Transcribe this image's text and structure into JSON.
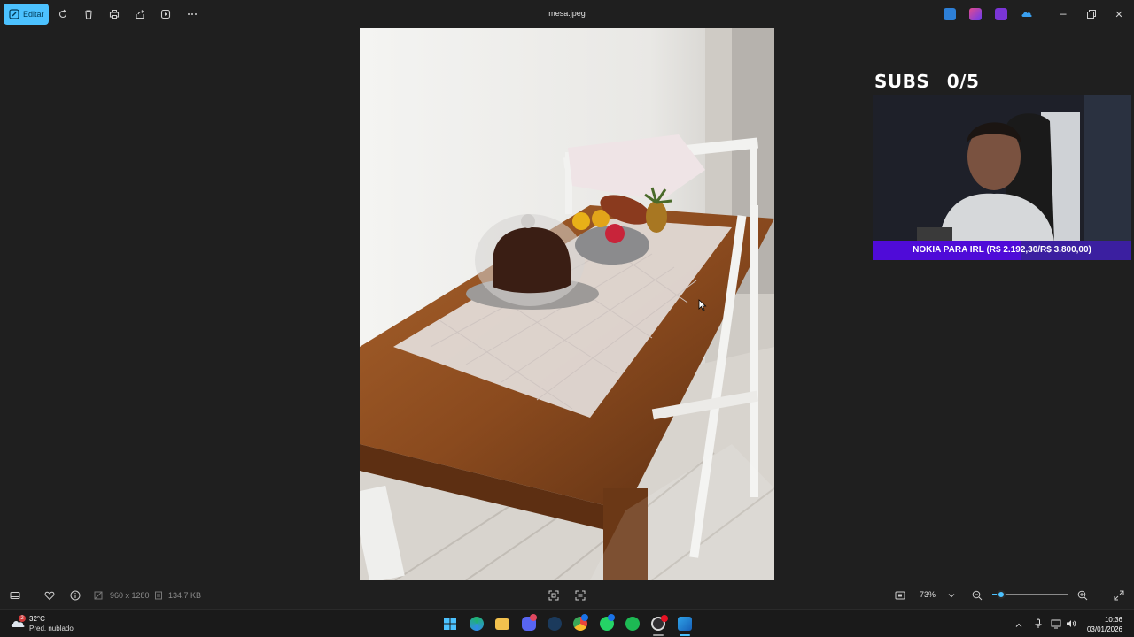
{
  "toolbar": {
    "edit_label": "Editar",
    "file_title": "mesa.jpeg",
    "icons": [
      "edit-icon",
      "rotate-icon",
      "delete-icon",
      "print-icon",
      "share-icon",
      "slideshow-icon",
      "more-icon"
    ]
  },
  "window_controls": [
    "minimize",
    "maximize",
    "close"
  ],
  "overlay": {
    "subs_label": "SUBS",
    "subs_count": "0/5",
    "goal_text": "NOKIA PARA IRL (R$ 2.192,30/R$ 3.800,00)",
    "goal_progress": 0.577
  },
  "bottom": {
    "dimensions": "960 x 1280",
    "file_size": "134.7 KB",
    "zoom": "73%",
    "zoom_slider_value": 0.12
  },
  "taskbar": {
    "temperature": "32°C",
    "weather": "Pred. nublado",
    "weather_badge": "2",
    "time": "10:36",
    "date": "03/01/2026",
    "apps": [
      "start",
      "edge",
      "file-explorer",
      "discord",
      "steam",
      "chrome",
      "whatsapp",
      "spotify",
      "obs",
      "photos"
    ]
  },
  "colors": {
    "accent": "#4cc2ff",
    "goal_bar": "#4f0bd8",
    "goal_bg": "#3b1fa0"
  }
}
